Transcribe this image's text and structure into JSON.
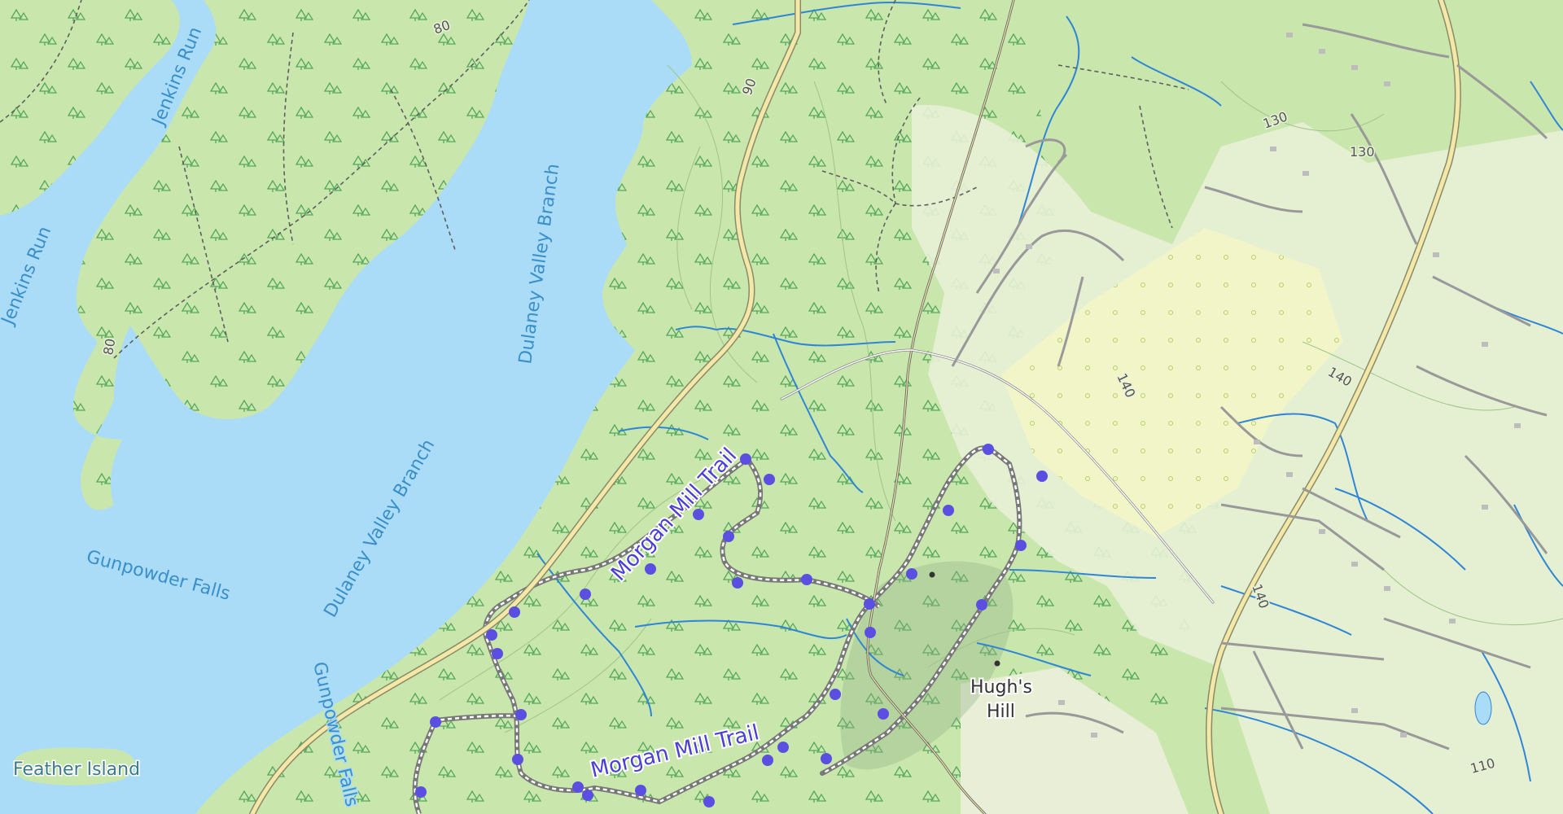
{
  "map": {
    "colors": {
      "water": "#aadcf8",
      "forest": "#c9e6ad",
      "open_land": "#e6edd2",
      "trail_marker": "#5a4fe0",
      "road": "#f3e8a8",
      "stream": "#2f86d6"
    },
    "water_labels": [
      "Jenkins Run",
      "Jenkins Run",
      "Dulaney Valley Branch",
      "Dulaney Valley Branch",
      "Gunpowder Falls",
      "Gunpowder Falls"
    ],
    "trail_labels": [
      "Morgan Mill Trail",
      "Morgan Mill Trail"
    ],
    "place_labels": {
      "hughs_hill_line1": "Hugh's",
      "hughs_hill_line2": "Hill",
      "feather_island": "Feather Island"
    },
    "elevation_labels": [
      "80",
      "90",
      "80",
      "130",
      "130",
      "140",
      "140",
      "140",
      "110"
    ],
    "icons": [
      "tree-icon",
      "trail-waypoint-icon",
      "summit-icon"
    ]
  }
}
